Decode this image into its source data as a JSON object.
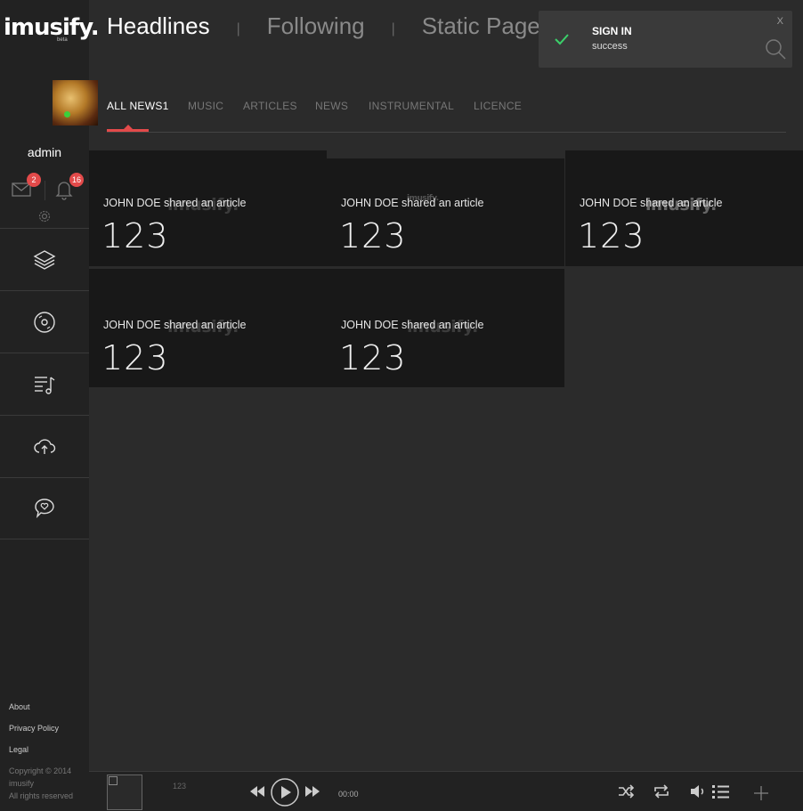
{
  "brand": {
    "logo_text": "imusify.",
    "beta_label": "beta"
  },
  "header": {
    "tabs": [
      {
        "label": "Headlines"
      },
      {
        "label": "Following"
      },
      {
        "label": "Static Page"
      }
    ],
    "separator": "|"
  },
  "toast": {
    "title": "SIGN IN",
    "message": "success",
    "close_label": "X"
  },
  "user": {
    "name": "admin",
    "messages_count": "2",
    "notifications_count": "16"
  },
  "subnav": {
    "items": [
      {
        "label": "ALL NEWS1"
      },
      {
        "label": "MUSIC"
      },
      {
        "label": "ARTICLES"
      },
      {
        "label": "NEWS"
      },
      {
        "label": "INSTRUMENTAL"
      },
      {
        "label": "LICENCE"
      }
    ]
  },
  "cards": [
    {
      "meta": "JOHN DOE shared an article",
      "value": "123",
      "watermark": "imusify."
    },
    {
      "meta": "JOHN DOE shared an article",
      "value": "123",
      "watermark": "imusify."
    },
    {
      "meta": "JOHN DOE shared an article",
      "value": "123",
      "watermark": "imusify."
    },
    {
      "meta": "JOHN DOE shared an article",
      "value": "123",
      "watermark": "imusify."
    },
    {
      "meta": "JOHN DOE shared an article",
      "value": "123",
      "watermark": "imusify."
    }
  ],
  "sidebar_nav": [
    {
      "icon": "layers-icon"
    },
    {
      "icon": "disc-icon"
    },
    {
      "icon": "playlist-icon"
    },
    {
      "icon": "upload-cloud-icon"
    },
    {
      "icon": "chat-heart-icon"
    }
  ],
  "footer": {
    "links": [
      {
        "label": "About"
      },
      {
        "label": "Privacy Policy"
      },
      {
        "label": "Legal"
      }
    ],
    "copyright_line1": "Copyright © 2014",
    "copyright_line2": "imusify",
    "copyright_line3": "All rights reserved"
  },
  "player": {
    "track": "123",
    "time": "00:00"
  }
}
